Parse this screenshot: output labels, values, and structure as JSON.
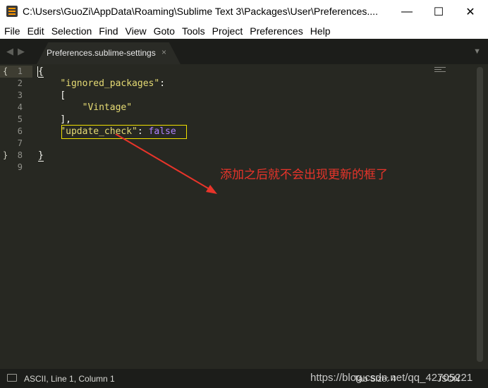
{
  "window": {
    "title": "C:\\Users\\GuoZi\\AppData\\Roaming\\Sublime Text 3\\Packages\\User\\Preferences....",
    "minimize_glyph": "—",
    "maximize_glyph": "☐",
    "close_glyph": "✕"
  },
  "menu": [
    "File",
    "Edit",
    "Selection",
    "Find",
    "View",
    "Goto",
    "Tools",
    "Project",
    "Preferences",
    "Help"
  ],
  "tab": {
    "label": "Preferences.sublime-settings",
    "close_glyph": "×",
    "back_glyph": "◀",
    "forward_glyph": "▶",
    "dropdown_glyph": "▼"
  },
  "editor": {
    "lines": [
      {
        "n": "1",
        "fold": "{"
      },
      {
        "n": "2"
      },
      {
        "n": "3"
      },
      {
        "n": "4"
      },
      {
        "n": "5"
      },
      {
        "n": "6"
      },
      {
        "n": "7"
      },
      {
        "n": "8",
        "fold": "}"
      },
      {
        "n": "9"
      }
    ],
    "code": {
      "l1_open": "{",
      "l2_indent": "    ",
      "l2_key": "\"ignored_packages\"",
      "l2_colon": ":",
      "l3": "    [",
      "l4_indent": "        ",
      "l4_value": "\"Vintage\"",
      "l5": "    ],",
      "l6_indent": "    ",
      "l6_key": "\"update_check\"",
      "l6_colon": ": ",
      "l6_value": "false",
      "l8_close": "}"
    }
  },
  "annotation": {
    "text": "添加之后就不会出现更新的框了",
    "color": "#e8342a"
  },
  "statusbar": {
    "position": "ASCII, Line 1, Column 1",
    "tab_size": "Tab Size: 4",
    "syntax": "JSON"
  },
  "watermark": "https://blog.csdn.net/qq_42705221"
}
